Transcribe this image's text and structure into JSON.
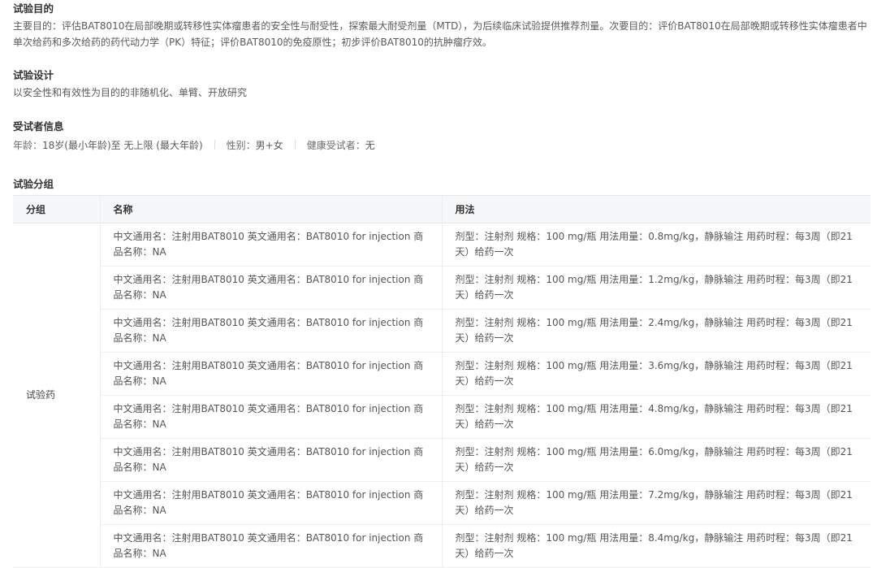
{
  "objective": {
    "title": "试验目的",
    "text": "主要目的：评估BAT8010在局部晚期或转移性实体瘤患者的安全性与耐受性，探索最大耐受剂量（MTD），为后续临床试验提供推荐剂量。次要目的：评价BAT8010在局部晚期或转移性实体瘤患者中单次给药和多次给药的药代动力学（PK）特征；评价BAT8010的免疫原性；初步评价BAT8010的抗肿瘤疗效。"
  },
  "design": {
    "title": "试验设计",
    "text": "以安全性和有效性为目的的非随机化、单臂、开放研究"
  },
  "subjects": {
    "title": "受试者信息",
    "age_label": "年龄：",
    "age_value": "18岁(最小年龄)至 无上限 (最大年龄)",
    "sex_label": "性别：",
    "sex_value": "男+女",
    "healthy_label": "健康受试者：",
    "healthy_value": "无"
  },
  "arms": {
    "title": "试验分组",
    "headers": [
      "分组",
      "名称",
      "用法"
    ],
    "group_label": "试验药",
    "rows": [
      {
        "name": "中文通用名：注射用BAT8010 英文通用名：BAT8010 for injection 商品名称：NA",
        "usage": "剂型：注射剂 规格：100 mg/瓶 用法用量：0.8mg/kg，静脉输注 用药时程：每3周（即21天）给药一次"
      },
      {
        "name": "中文通用名：注射用BAT8010 英文通用名：BAT8010 for injection 商品名称：NA",
        "usage": "剂型：注射剂 规格：100 mg/瓶 用法用量：1.2mg/kg，静脉输注 用药时程：每3周（即21天）给药一次"
      },
      {
        "name": "中文通用名：注射用BAT8010 英文通用名：BAT8010 for injection 商品名称：NA",
        "usage": "剂型：注射剂 规格：100 mg/瓶 用法用量：2.4mg/kg，静脉输注 用药时程：每3周（即21天）给药一次"
      },
      {
        "name": "中文通用名：注射用BAT8010 英文通用名：BAT8010 for injection 商品名称：NA",
        "usage": "剂型：注射剂 规格：100 mg/瓶 用法用量：3.6mg/kg，静脉输注 用药时程：每3周（即21天）给药一次"
      },
      {
        "name": "中文通用名：注射用BAT8010 英文通用名：BAT8010 for injection 商品名称：NA",
        "usage": "剂型：注射剂 规格：100 mg/瓶 用法用量：4.8mg/kg，静脉输注 用药时程：每3周（即21天）给药一次"
      },
      {
        "name": "中文通用名：注射用BAT8010 英文通用名：BAT8010 for injection 商品名称：NA",
        "usage": "剂型：注射剂 规格：100 mg/瓶 用法用量：6.0mg/kg，静脉输注 用药时程：每3周（即21天）给药一次"
      },
      {
        "name": "中文通用名：注射用BAT8010 英文通用名：BAT8010 for injection 商品名称：NA",
        "usage": "剂型：注射剂 规格：100 mg/瓶 用法用量：7.2mg/kg，静脉输注 用药时程：每3周（即21天）给药一次"
      },
      {
        "name": "中文通用名：注射用BAT8010 英文通用名：BAT8010 for injection 商品名称：NA",
        "usage": "剂型：注射剂 规格：100 mg/瓶 用法用量：8.4mg/kg，静脉输注 用药时程：每3周（即21天）给药一次"
      }
    ]
  }
}
